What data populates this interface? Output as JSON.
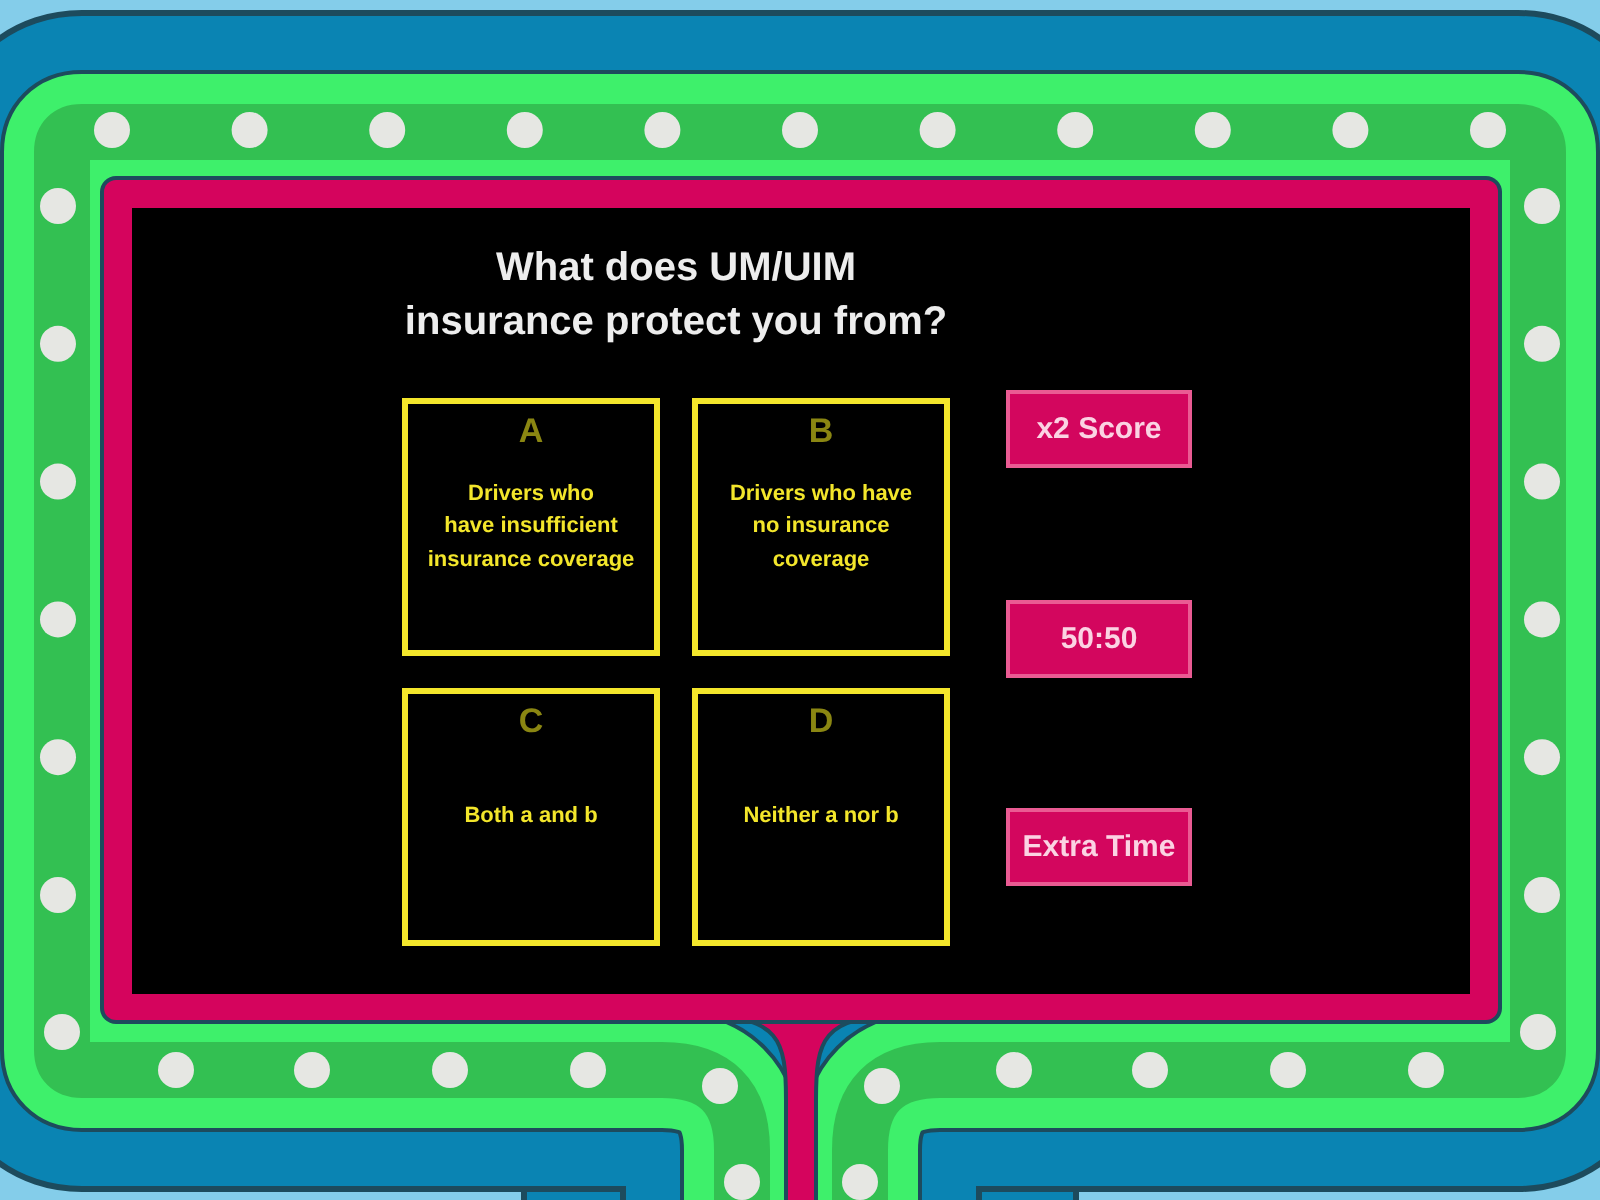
{
  "question": "What does UM/UIM insurance protect you from?",
  "answers": [
    {
      "letter": "A",
      "text": "Drivers who\nhave insufficient\ninsurance coverage"
    },
    {
      "letter": "B",
      "text": "Drivers who have\nno insurance\ncoverage"
    },
    {
      "letter": "C",
      "text": "Both a and b"
    },
    {
      "letter": "D",
      "text": "Neither a nor b"
    }
  ],
  "power_ups": [
    "x2 Score",
    "50:50",
    "Extra Time"
  ]
}
